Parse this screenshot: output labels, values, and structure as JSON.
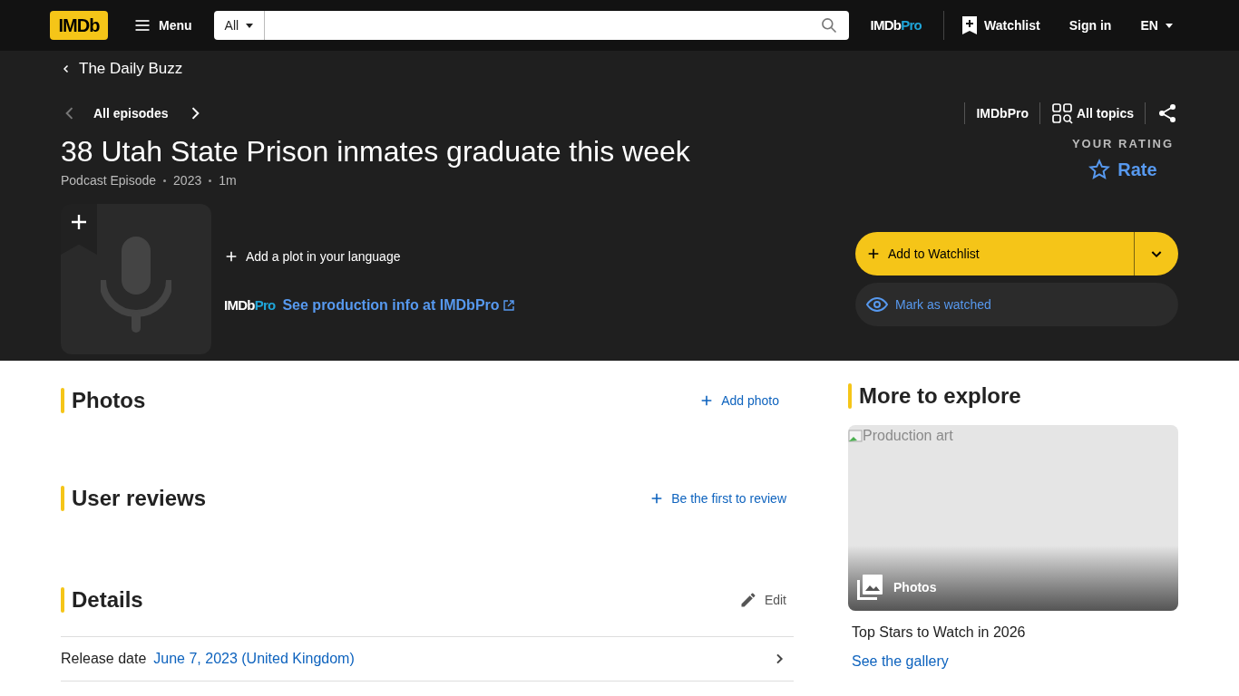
{
  "header": {
    "logo": "IMDb",
    "menu": "Menu",
    "search": {
      "category": "All"
    },
    "pro_logo": {
      "imdb": "IMDb",
      "pro": "Pro"
    },
    "watchlist": "Watchlist",
    "sign_in": "Sign in",
    "language": "EN"
  },
  "hero": {
    "parent": "The Daily Buzz",
    "episode_nav": {
      "label": "All episodes",
      "prev_disabled": true,
      "next_disabled": false
    },
    "links": [
      "IMDbPro",
      "All topics"
    ],
    "title": "38 Utah State Prison inmates graduate this week",
    "meta": [
      "Podcast Episode",
      "2023",
      "1m"
    ],
    "rating": {
      "label": "YOUR RATING",
      "action": "Rate"
    },
    "add_plot": "Add a plot in your language",
    "pro_promo": {
      "logo_imdb": "IMDb",
      "logo_pro": "Pro",
      "link": "See production info at IMDbPro"
    },
    "watchlist_button": "Add to Watchlist",
    "watched_button": "Mark as watched"
  },
  "sections": [
    {
      "title": "Photos",
      "action": "Add photo",
      "kind": "add"
    },
    {
      "title": "User reviews",
      "action": "Be the first to review",
      "kind": "add"
    },
    {
      "title": "Details",
      "action": "Edit",
      "kind": "edit",
      "rows": [
        {
          "label": "Release date",
          "value": "June 7, 2023 (United Kingdom)"
        }
      ]
    }
  ],
  "explore": {
    "title": "More to explore",
    "card": {
      "alt": "Production art",
      "badge": "Photos",
      "caption": "Top Stars to Watch in 2026",
      "link": "See the gallery"
    }
  }
}
